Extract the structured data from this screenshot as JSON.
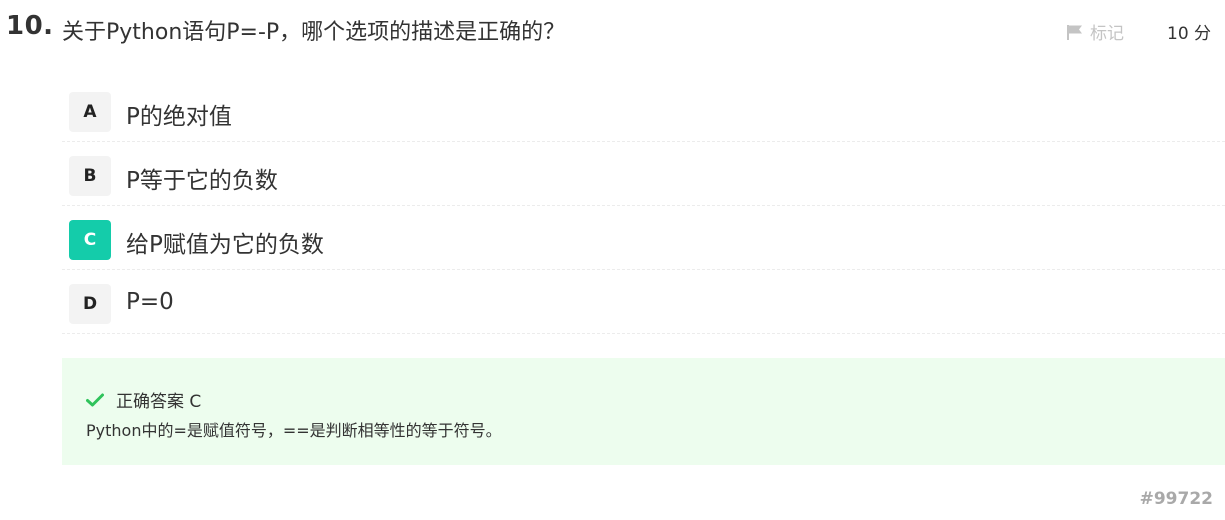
{
  "question": {
    "number": "10.",
    "text": "关于Python语句P=-P，哪个选项的描述是正确的？",
    "mark_label": "标记",
    "score": "10 分",
    "mark_icon": "flag-icon"
  },
  "options": [
    {
      "letter": "A",
      "text": "P的绝对值",
      "correct": false
    },
    {
      "letter": "B",
      "text": "P等于它的负数",
      "correct": false
    },
    {
      "letter": "C",
      "text": "给P赋值为它的负数",
      "correct": true
    },
    {
      "letter": "D",
      "text": "P=0",
      "correct": false
    }
  ],
  "answer": {
    "title": "正确答案 C",
    "explanation": "Python中的=是赋值符号，==是判断相等性的等于符号。",
    "icon": "check-icon"
  },
  "question_id": "#99722",
  "colors": {
    "correct_badge": "#14ccaa",
    "answer_bg": "#edfdee",
    "check": "#2fc35b",
    "muted": "#c4c4c4"
  }
}
